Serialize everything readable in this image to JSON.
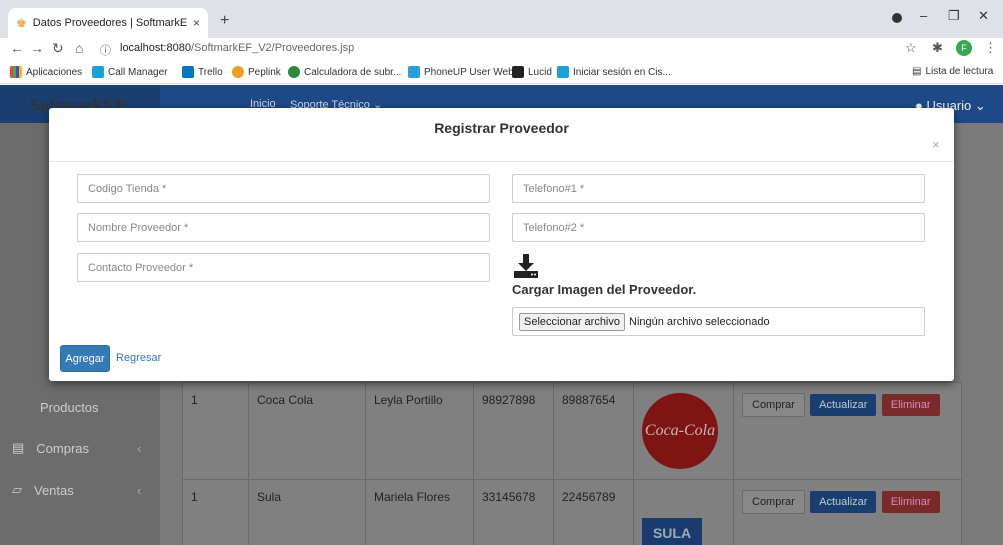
{
  "browser": {
    "tab_title": "Datos Proveedores | SoftmarkEF",
    "tab_close": "×",
    "new_tab": "+",
    "url_host": "localhost:8080",
    "url_path": "/SoftmarkEF_V2/Proveedores.jsp",
    "win_min": "–",
    "win_max": "❐",
    "win_close": "✕",
    "avatar_letter": "F",
    "reading_list": "Lista de lectura",
    "bookmarks": [
      "Aplicaciones",
      "Call Manager",
      "Trello",
      "Peplink",
      "Calculadora de subr...",
      "PhoneUP User Web...",
      "Lucid",
      "Iniciar sesión en Cis..."
    ]
  },
  "app": {
    "brand": "SoftmarkEF",
    "nav_inicio": "Inicio",
    "nav_soporte": "Soporte Técnico ⌄",
    "user_menu": "Usuario ⌄",
    "sidebar": [
      {
        "label": "Productos"
      },
      {
        "label": "Compras"
      },
      {
        "label": "Ventas"
      }
    ],
    "rows": [
      {
        "codigo": "1",
        "nombre": "Coca Cola",
        "contacto": "Leyla Portillo",
        "tel1": "98927898",
        "tel2": "89887654",
        "logo": "Coca-Cola"
      },
      {
        "codigo": "1",
        "nombre": "Sula",
        "contacto": "Mariela Flores",
        "tel1": "33145678",
        "tel2": "22456789",
        "logo": "SULA"
      }
    ],
    "actions": {
      "comprar": "Comprar",
      "actualizar": "Actualizar",
      "eliminar": "Eliminar"
    }
  },
  "modal": {
    "title": "Registrar Proveedor",
    "close": "×",
    "placeholders": {
      "codigo_tienda": "Codigo Tienda *",
      "nombre_proveedor": "Nombre Proveedor *",
      "contacto_proveedor": "Contacto Proveedor *",
      "telefono1": "Telefono#1 *",
      "telefono2": "Telefono#2 *"
    },
    "upload_label": "Cargar Imagen del Proveedor.",
    "file_button": "Seleccionar archivo",
    "file_status": "Ningún archivo seleccionado",
    "submit": "Agregar",
    "back": "Regresar"
  },
  "colors": {
    "primary": "#337ab7",
    "header": "#1d4a87"
  }
}
